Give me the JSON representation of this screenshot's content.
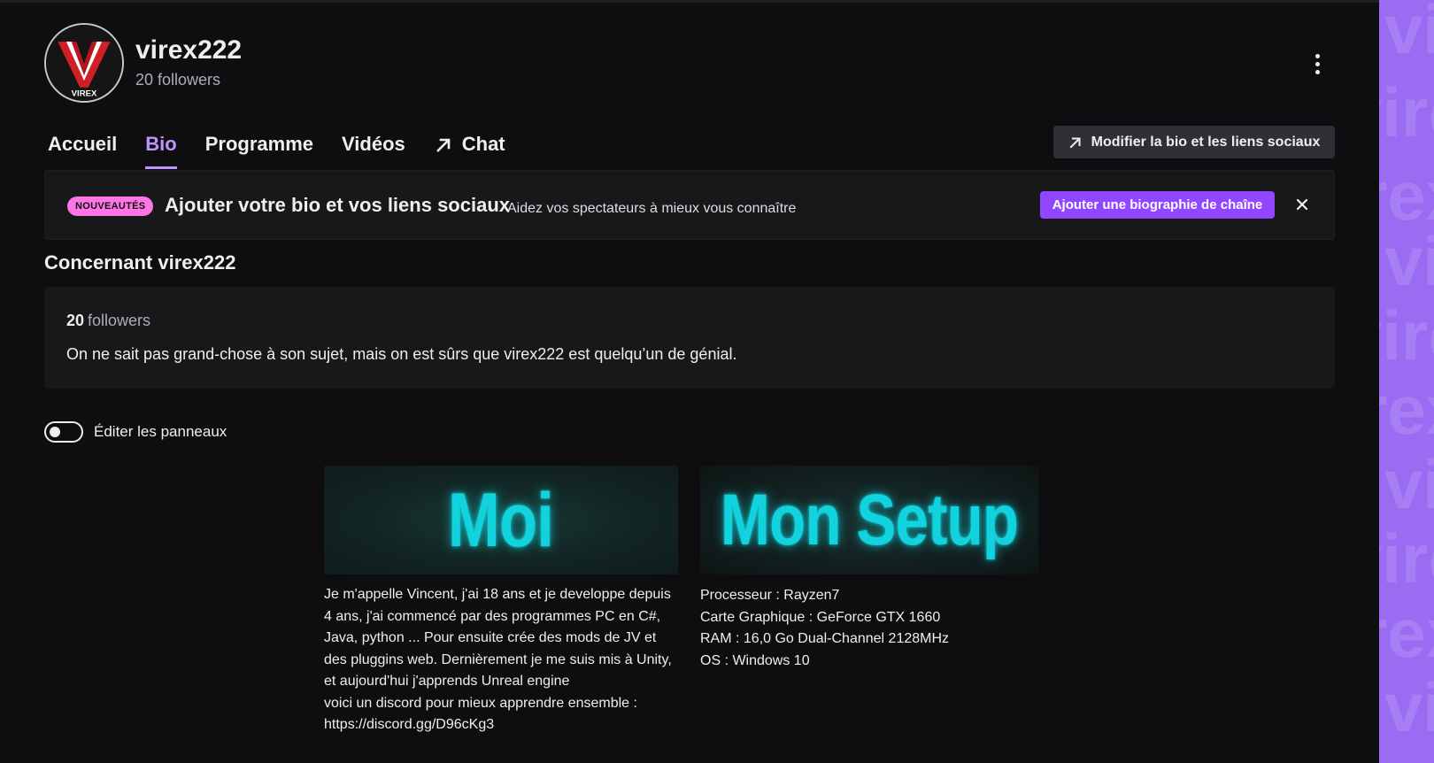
{
  "channel": {
    "name": "virex222",
    "followers_label": "20 followers",
    "logo_text": "VIREX"
  },
  "tabs": [
    {
      "label": "Accueil",
      "active": false
    },
    {
      "label": "Bio",
      "active": true
    },
    {
      "label": "Programme",
      "active": false
    },
    {
      "label": "Vidéos",
      "active": false
    },
    {
      "label": "Chat",
      "active": false,
      "icon": "external-arrow-icon"
    }
  ],
  "edit_bio_button": {
    "label": "Modifier la bio et les liens sociaux",
    "icon": "external-arrow-icon"
  },
  "banner": {
    "badge": "NOUVEAUTÉS",
    "title": "Ajouter votre bio et vos liens sociaux",
    "subtitle": "Aidez vos spectateurs à mieux vous connaître",
    "cta_label": "Ajouter une biographie de chaîne",
    "close_icon": "close-icon"
  },
  "about": {
    "title": "Concernant virex222",
    "followers_count": "20",
    "followers_word": "followers",
    "description": "On ne sait pas grand-chose à son sujet, mais on est sûrs que virex222 est quelqu’un de génial."
  },
  "edit_panels": {
    "label": "Éditer les panneaux",
    "enabled": false
  },
  "panels": [
    {
      "heading": "Moi",
      "lines": [
        "Je m'appelle Vincent, j'ai 18 ans et je developpe depuis 4 ans, j'ai commencé par des programmes PC en C#, Java, python ... Pour ensuite crée des mods de JV et des pluggins web. Dernièrement je me suis mis à Unity, et aujourd'hui j'apprends Unreal engine",
        "voici un discord pour mieux apprendre ensemble :",
        "https://discord.gg/D96cKg3"
      ]
    },
    {
      "heading": "Mon Setup",
      "lines": [
        "Processeur : Rayzen7",
        "Carte Graphique : GeForce GTX 1660",
        "RAM : 16,0 Go Dual-Channel 2128MHz",
        "OS : Windows 10"
      ]
    }
  ],
  "colors": {
    "background": "#0e0e10",
    "accent": "#bf94ff",
    "button_primary": "#9147ff",
    "badge": "#ff75e6",
    "side_panel": "#9b6bf2",
    "panel_heading": "#12d3dd"
  }
}
